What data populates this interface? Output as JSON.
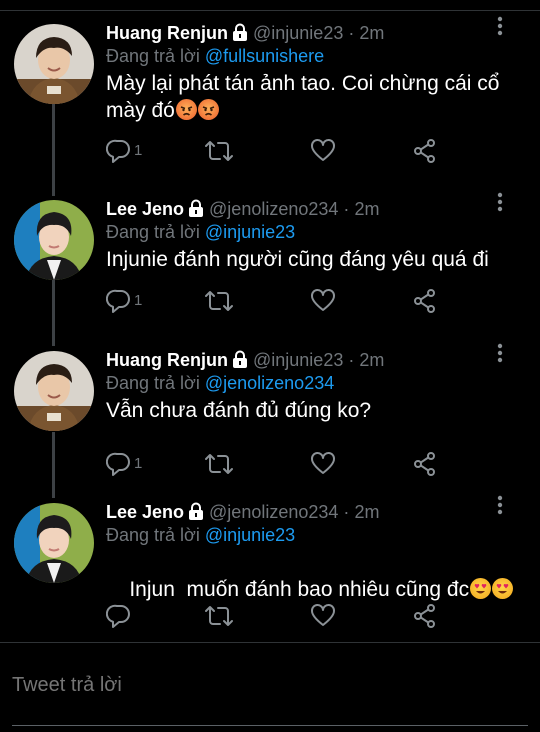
{
  "tweets": [
    {
      "name": "Huang Renjun",
      "handle": "@injunie23",
      "separator": "·",
      "time": "2m",
      "replying_prefix": "Đang trả lời",
      "replying_to": "@fullsunishere",
      "text_line1": "Mày lại phát tán ảnh tao. Coi chừng cái cổ",
      "text_line2": "mày đó",
      "emojis": [
        "angry-face",
        "angry-face"
      ],
      "reply_count": "1",
      "avatar": "renjun"
    },
    {
      "name": "Lee Jeno",
      "handle": "@jenolizeno234",
      "separator": "·",
      "time": "2m",
      "replying_prefix": "Đang trả lời",
      "replying_to": "@injunie23",
      "text_line1": "Injunie đánh người cũng đáng yêu quá đi",
      "reply_count": "1",
      "avatar": "jeno"
    },
    {
      "name": "Huang Renjun",
      "handle": "@injunie23",
      "separator": "·",
      "time": "2m",
      "replying_prefix": "Đang trả lời",
      "replying_to": "@jenolizeno234",
      "text_line1": "Vẫn chưa đánh đủ đúng ko?",
      "reply_count": "1",
      "avatar": "renjun"
    },
    {
      "name": "Lee Jeno",
      "handle": "@jenolizeno234",
      "separator": "·",
      "time": "2m",
      "replying_prefix": "Đang trả lời",
      "replying_to": "@injunie23",
      "text_line1": "Injun  muốn đánh bao nhiêu cũng đc",
      "emojis": [
        "heart-eyes-face",
        "heart-eyes-face"
      ],
      "reply_count": "",
      "avatar": "jeno"
    }
  ],
  "reply_box": {
    "placeholder": "Tweet trả lời"
  },
  "colors": {
    "background": "#000000",
    "muted": "#71767b",
    "link": "#1d9bf0",
    "divider": "#2f3336"
  }
}
